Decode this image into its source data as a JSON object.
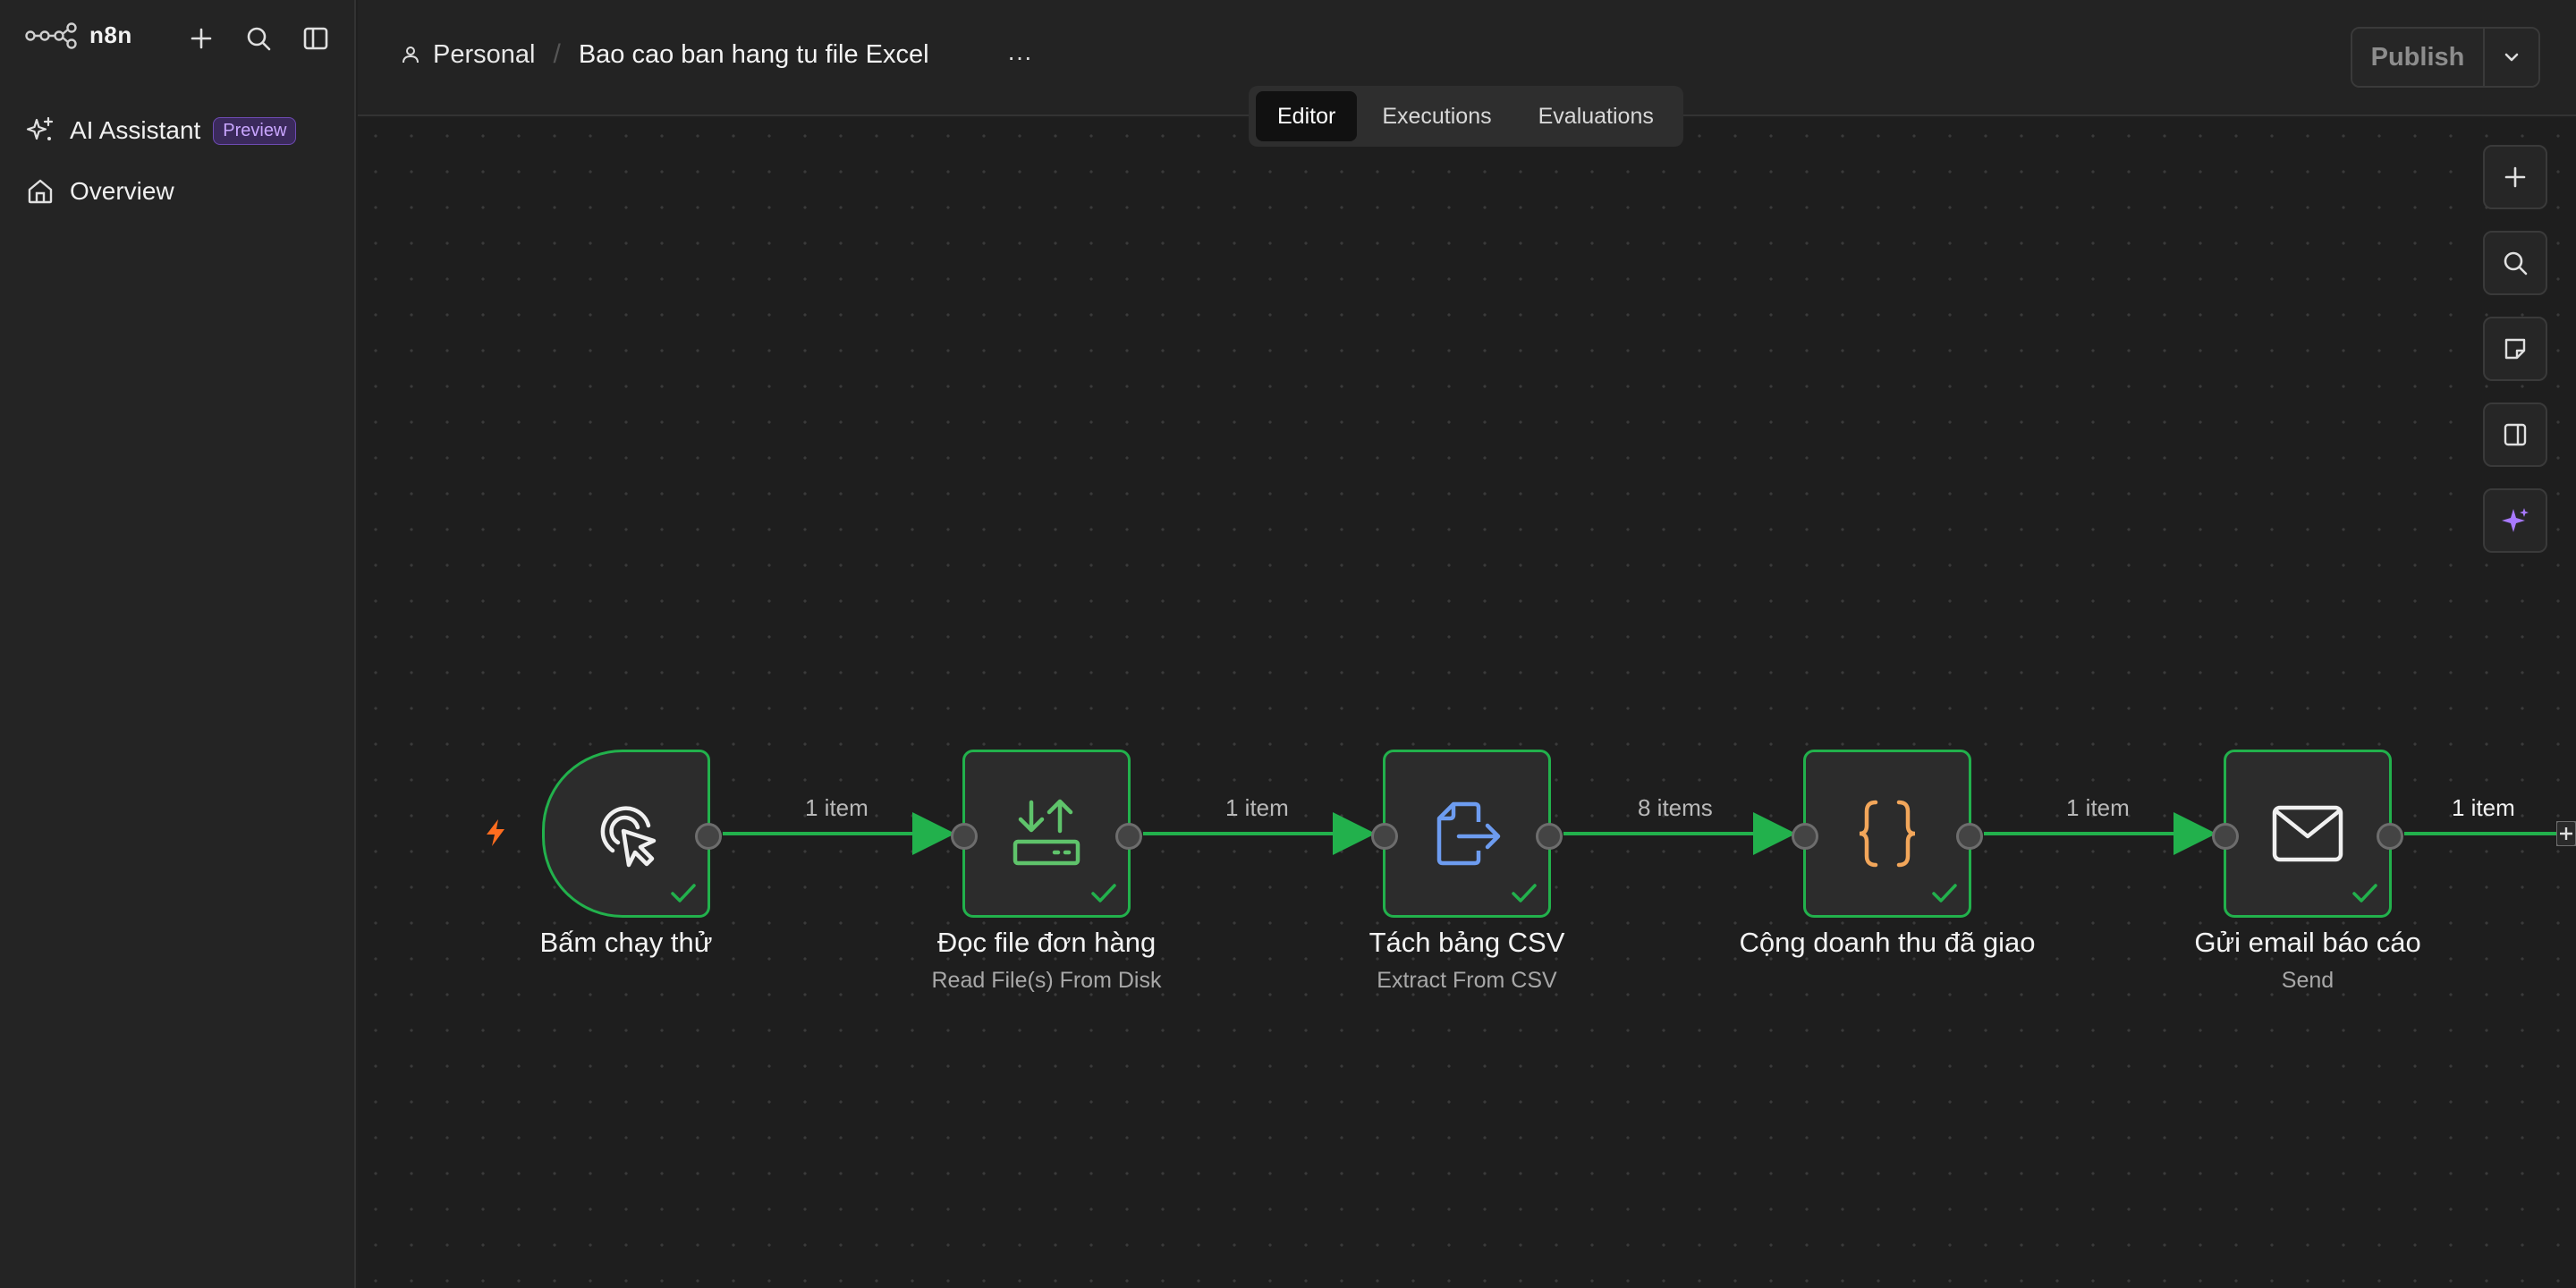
{
  "brand": {
    "name": "n8n"
  },
  "sidebar": {
    "items": [
      {
        "label": "AI Assistant",
        "badge": "Preview"
      },
      {
        "label": "Overview"
      }
    ]
  },
  "header": {
    "project": "Personal",
    "workflow_name": "Bao cao ban hang tu file Excel",
    "more": "···",
    "publish_label": "Publish"
  },
  "tabs": [
    {
      "label": "Editor",
      "active": true
    },
    {
      "label": "Executions",
      "active": false
    },
    {
      "label": "Evaluations",
      "active": false
    }
  ],
  "canvas_tools": [
    "zoom-in-icon",
    "search-icon",
    "sticky-note-icon",
    "panel-icon",
    "ai-sparkle-icon"
  ],
  "nodes": [
    {
      "title": "Bấm chạy thử",
      "subtitle": "",
      "icon": "cursor-click-icon",
      "status": "success"
    },
    {
      "title": "Đọc file đơn hàng",
      "subtitle": "Read File(s) From Disk",
      "icon": "file-transfer-icon",
      "status": "success"
    },
    {
      "title": "Tách bảng CSV",
      "subtitle": "Extract From CSV",
      "icon": "extract-file-icon",
      "status": "success"
    },
    {
      "title": "Cộng doanh thu đã giao",
      "subtitle": "",
      "icon": "code-braces-icon",
      "status": "success"
    },
    {
      "title": "Gửi email báo cáo",
      "subtitle": "Send",
      "icon": "envelope-icon",
      "status": "success"
    }
  ],
  "edges": [
    {
      "label": "1 item"
    },
    {
      "label": "1 item"
    },
    {
      "label": "8 items"
    },
    {
      "label": "1 item"
    },
    {
      "label": "1 item"
    }
  ],
  "colors": {
    "success": "#22b14c",
    "accent_purple": "#a879ff",
    "trigger_bolt": "#ff6d1f",
    "code_orange": "#f2a65a",
    "csv_blue": "#6d9cf0",
    "file_green": "#5fc36b"
  }
}
